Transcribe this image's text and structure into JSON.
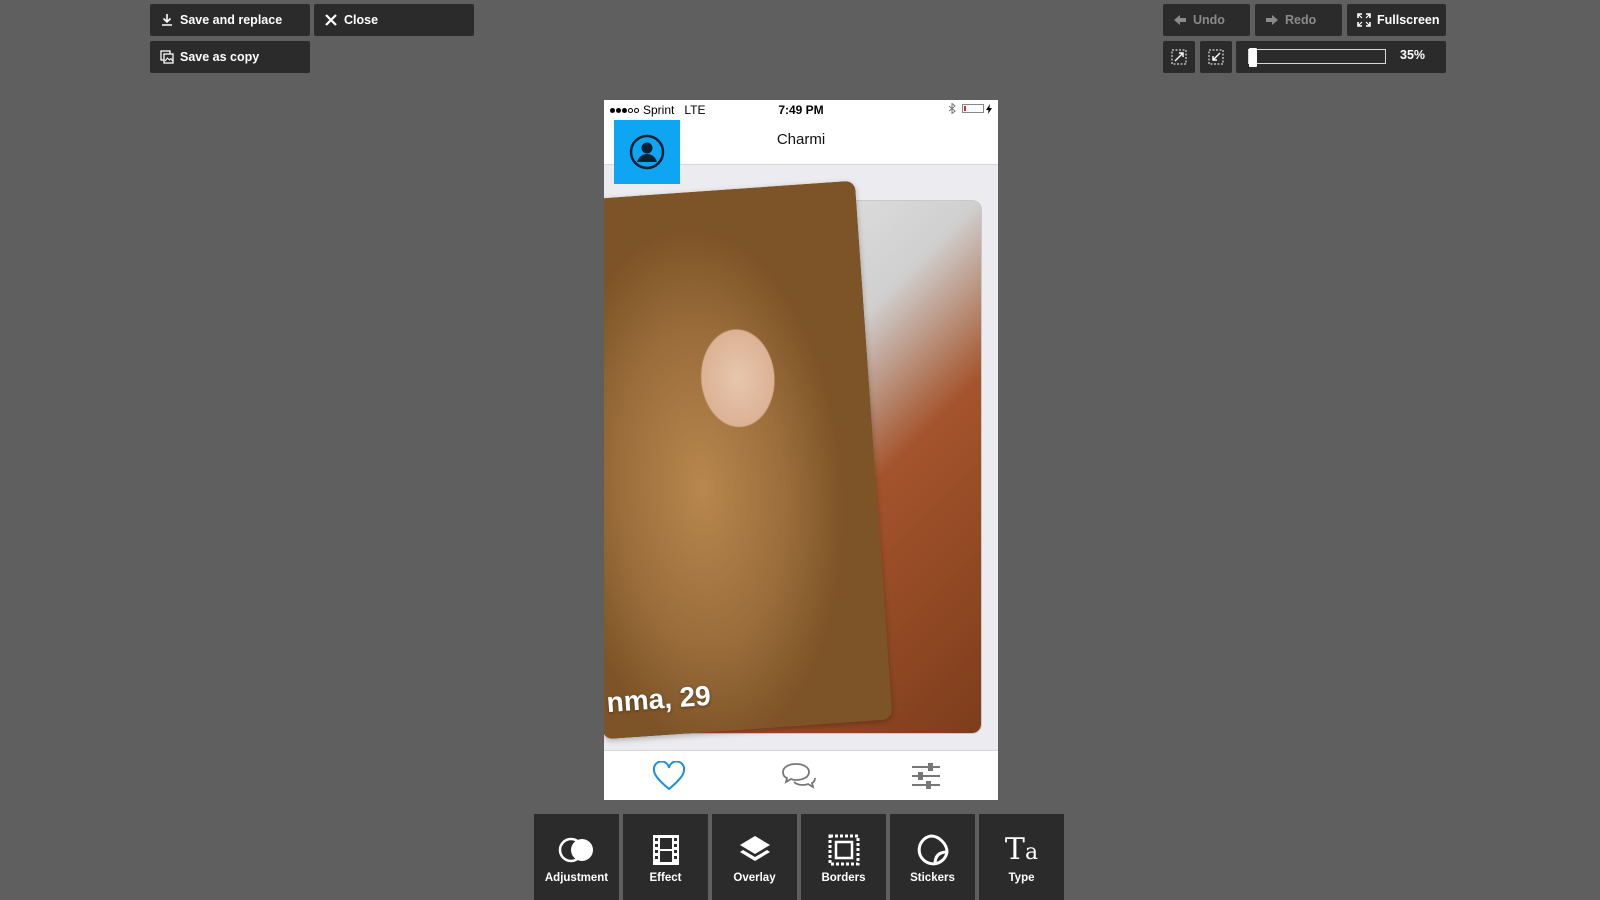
{
  "toolbar": {
    "save_replace": "Save and replace",
    "close": "Close",
    "save_copy": "Save as copy",
    "undo": "Undo",
    "redo": "Redo",
    "fullscreen": "Fullscreen",
    "zoom_label": "35%",
    "zoom_level": 0.02
  },
  "phone": {
    "carrier": "Sprint",
    "network": "LTE",
    "time": "7:49 PM",
    "nav_title": "Charmi",
    "card_name": "nma, 29"
  },
  "tools": [
    {
      "label": "Adjustment",
      "icon": "adjustment-icon"
    },
    {
      "label": "Effect",
      "icon": "film-icon"
    },
    {
      "label": "Overlay",
      "icon": "layers-icon"
    },
    {
      "label": "Borders",
      "icon": "border-frame-icon"
    },
    {
      "label": "Stickers",
      "icon": "sticker-icon"
    },
    {
      "label": "Type",
      "icon": "type-icon"
    }
  ],
  "colors": {
    "background": "#5f5f5f",
    "button": "#2b2b2b",
    "accent_blue": "#0ea6f2"
  }
}
